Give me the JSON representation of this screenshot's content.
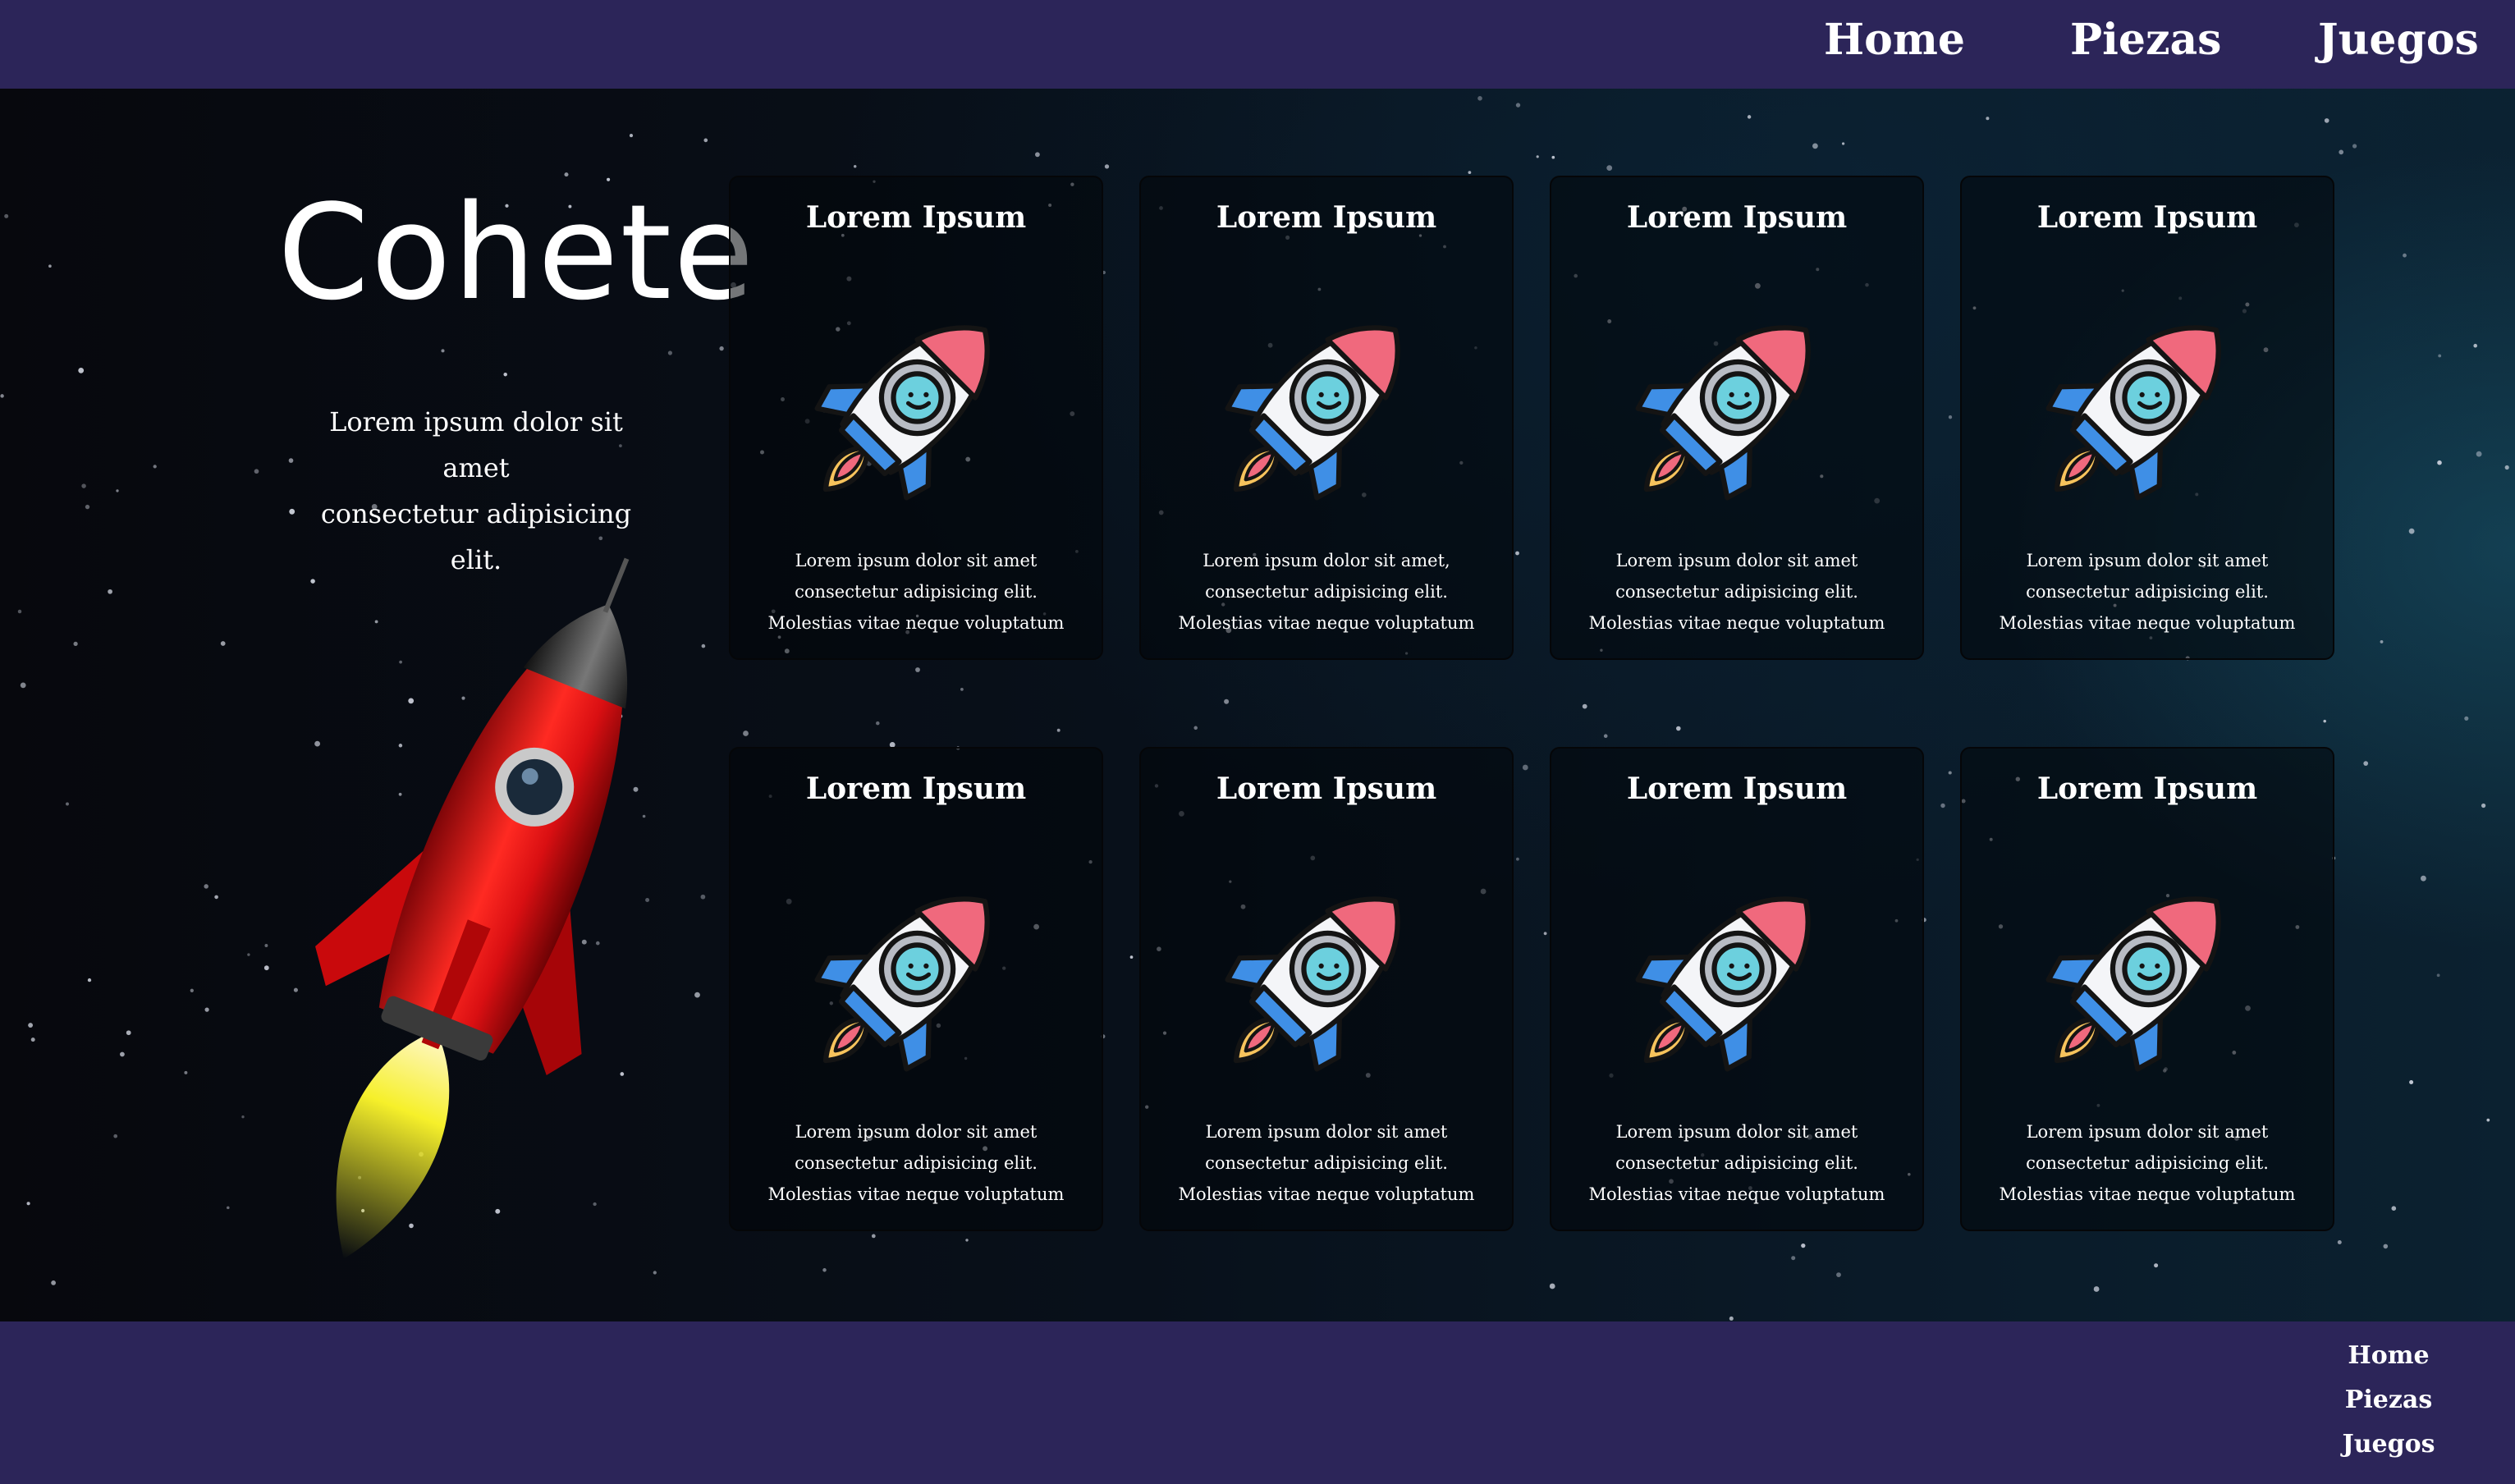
{
  "nav": {
    "items": [
      "Home",
      "Piezas",
      "Juegos"
    ]
  },
  "hero": {
    "title": "Cohete",
    "intro_line1": "Lorem ipsum dolor sit amet",
    "intro_line2": "consectetur adipisicing elit."
  },
  "cards": [
    {
      "title": "Lorem Ipsum",
      "lines": [
        "Lorem ipsum dolor sit amet",
        "consectetur adipisicing elit.",
        "Molestias vitae neque voluptatum"
      ]
    },
    {
      "title": "Lorem Ipsum",
      "lines": [
        "Lorem ipsum dolor sit amet,",
        "consectetur adipisicing elit.",
        "Molestias vitae neque voluptatum"
      ]
    },
    {
      "title": "Lorem Ipsum",
      "lines": [
        "Lorem ipsum dolor sit amet",
        "consectetur adipisicing elit.",
        "Molestias vitae neque voluptatum"
      ]
    },
    {
      "title": "Lorem Ipsum",
      "lines": [
        "Lorem ipsum dolor sit amet",
        "consectetur adipisicing elit.",
        "Molestias vitae neque voluptatum"
      ]
    },
    {
      "title": "Lorem Ipsum",
      "lines": [
        "Lorem ipsum dolor sit amet",
        "consectetur adipisicing elit.",
        "Molestias vitae neque voluptatum"
      ]
    },
    {
      "title": "Lorem Ipsum",
      "lines": [
        "Lorem ipsum dolor sit amet",
        "consectetur adipisicing elit.",
        "Molestias vitae neque voluptatum"
      ]
    },
    {
      "title": "Lorem Ipsum",
      "lines": [
        "Lorem ipsum dolor sit amet",
        "consectetur adipisicing elit.",
        "Molestias vitae neque voluptatum"
      ]
    },
    {
      "title": "Lorem Ipsum",
      "lines": [
        "Lorem ipsum dolor sit amet",
        "consectetur adipisicing elit.",
        "Molestias vitae neque voluptatum"
      ]
    }
  ],
  "footer": {
    "items": [
      "Home",
      "Piezas",
      "Juegos"
    ]
  },
  "colors": {
    "bar": "#2c2559",
    "background": "#07080d",
    "text": "#ffffff"
  },
  "icons": {
    "hero": "red-rocket-icon",
    "card": "cartoon-rocket-icon"
  }
}
